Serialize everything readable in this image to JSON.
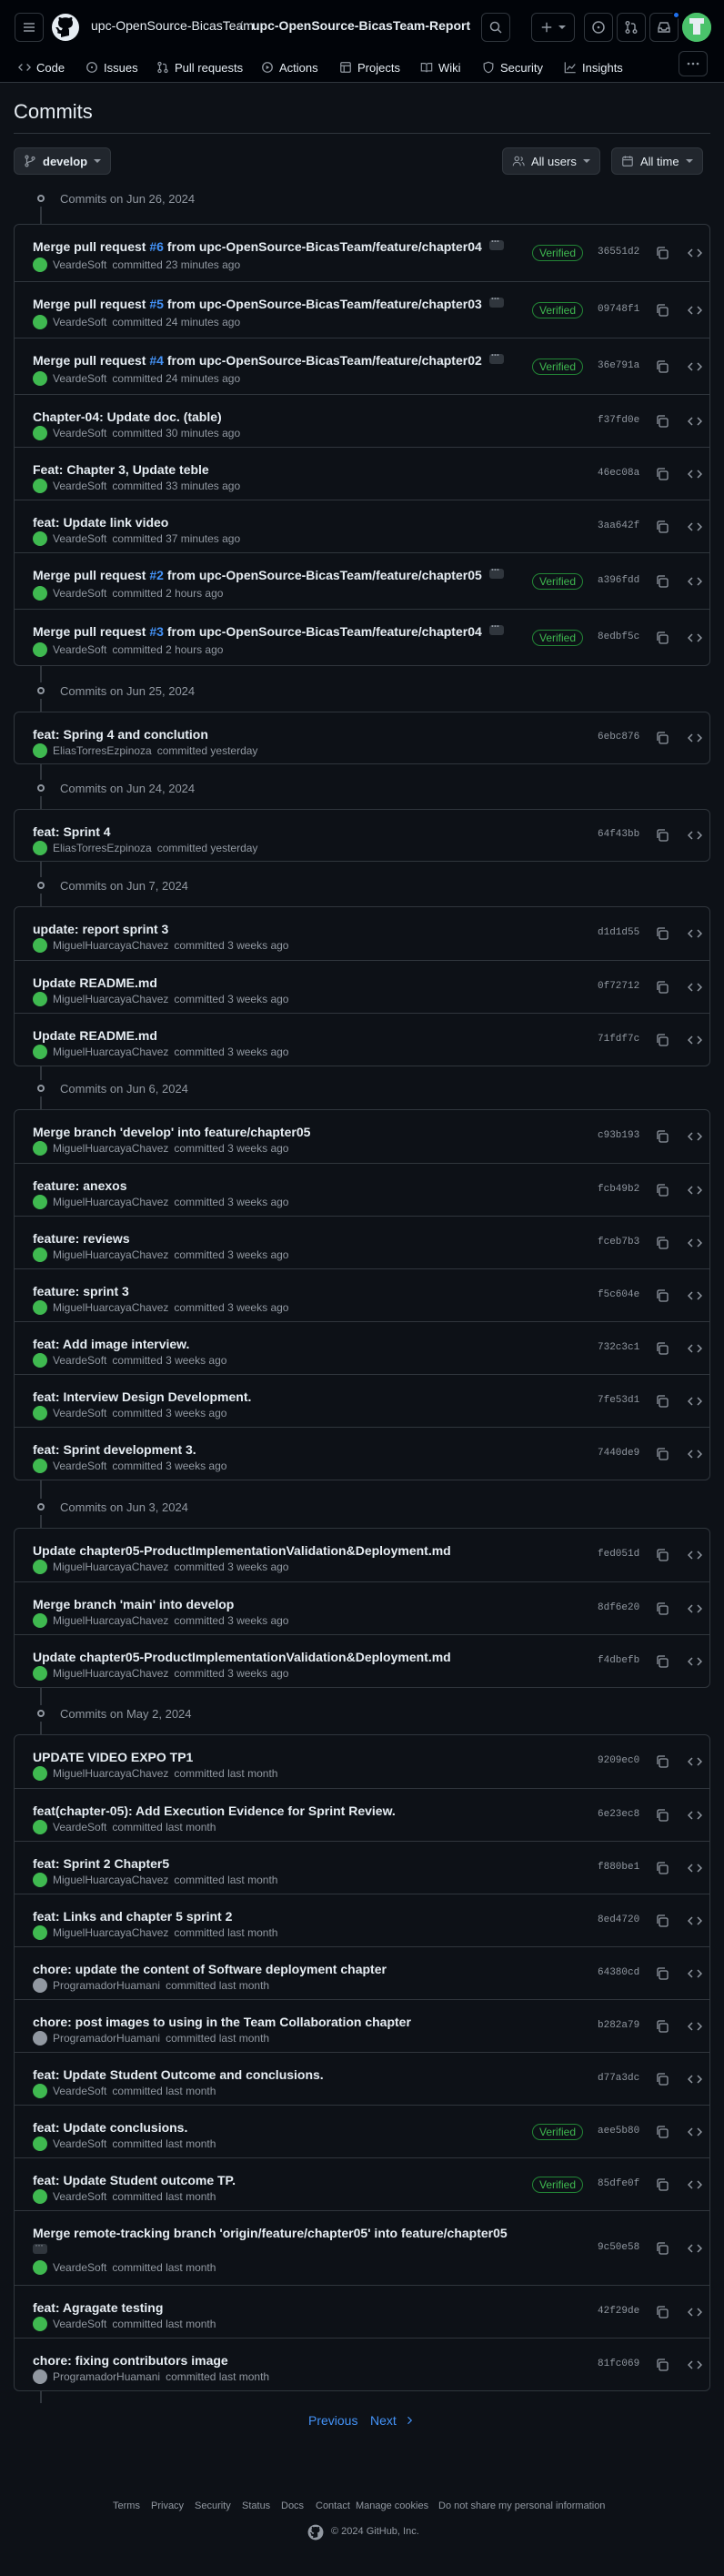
{
  "header": {
    "owner": "upc-OpenSource-BicasTeam",
    "separator": "/",
    "repo": "upc-OpenSource-BicasTeam-Report"
  },
  "tabs": [
    "Code",
    "Issues",
    "Pull requests",
    "Actions",
    "Projects",
    "Wiki",
    "Security",
    "Insights"
  ],
  "page_title": "Commits",
  "filters": {
    "branch": "develop",
    "users": "All users",
    "time": "All time"
  },
  "groups": [
    {
      "date": "Commits on Jun 26, 2024",
      "commits": [
        {
          "pre": "Merge pull request ",
          "pr": "#6",
          "post": " from upc-OpenSource-BicasTeam/feature/chapter04",
          "author": "VeardeSoft",
          "time": "committed 23 minutes ago",
          "sha": "36551d2",
          "verified": "Verified",
          "dots": true
        },
        {
          "pre": "Merge pull request ",
          "pr": "#5",
          "post": " from upc-OpenSource-BicasTeam/feature/chapter03",
          "author": "VeardeSoft",
          "time": "committed 24 minutes ago",
          "sha": "09748f1",
          "verified": "Verified",
          "dots": true
        },
        {
          "pre": "Merge pull request ",
          "pr": "#4",
          "post": " from upc-OpenSource-BicasTeam/feature/chapter02",
          "author": "VeardeSoft",
          "time": "committed 24 minutes ago",
          "sha": "36e791a",
          "verified": "Verified",
          "dots": true
        },
        {
          "pre": "Chapter-04: Update doc. (table)",
          "author": "VeardeSoft",
          "time": "committed 30 minutes ago",
          "sha": "f37fd0e"
        },
        {
          "pre": "Feat: Chapter 3, Update teble",
          "author": "VeardeSoft",
          "time": "committed 33 minutes ago",
          "sha": "46ec08a"
        },
        {
          "pre": "feat: Update link video",
          "author": "VeardeSoft",
          "time": "committed 37 minutes ago",
          "sha": "3aa642f"
        },
        {
          "pre": "Merge pull request ",
          "pr": "#2",
          "post": " from upc-OpenSource-BicasTeam/feature/chapter05",
          "author": "VeardeSoft",
          "time": "committed 2 hours ago",
          "sha": "a396fdd",
          "verified": "Verified",
          "dots": true
        },
        {
          "pre": "Merge pull request ",
          "pr": "#3",
          "post": " from upc-OpenSource-BicasTeam/feature/chapter04",
          "author": "VeardeSoft",
          "time": "committed 2 hours ago",
          "sha": "8edbf5c",
          "verified": "Verified",
          "dots": true
        }
      ]
    },
    {
      "date": "Commits on Jun 25, 2024",
      "commits": [
        {
          "pre": "feat: Spring 4 and conclution",
          "author": "EliasTorresEzpinoza",
          "time": "committed yesterday",
          "sha": "6ebc876"
        }
      ]
    },
    {
      "date": "Commits on Jun 24, 2024",
      "commits": [
        {
          "pre": "feat: Sprint 4",
          "author": "EliasTorresEzpinoza",
          "time": "committed yesterday",
          "sha": "64f43bb"
        }
      ]
    },
    {
      "date": "Commits on Jun 7, 2024",
      "commits": [
        {
          "pre": "update: report sprint 3",
          "author": "MiguelHuarcayaChavez",
          "time": "committed 3 weeks ago",
          "sha": "d1d1d55"
        },
        {
          "pre": "Update README.md",
          "author": "MiguelHuarcayaChavez",
          "time": "committed 3 weeks ago",
          "sha": "0f72712"
        },
        {
          "pre": "Update README.md",
          "author": "MiguelHuarcayaChavez",
          "time": "committed 3 weeks ago",
          "sha": "71fdf7c"
        }
      ]
    },
    {
      "date": "Commits on Jun 6, 2024",
      "commits": [
        {
          "pre": "Merge branch 'develop' into feature/chapter05",
          "author": "MiguelHuarcayaChavez",
          "time": "committed 3 weeks ago",
          "sha": "c93b193"
        },
        {
          "pre": "feature: anexos",
          "author": "MiguelHuarcayaChavez",
          "time": "committed 3 weeks ago",
          "sha": "fcb49b2"
        },
        {
          "pre": "feature: reviews",
          "author": "MiguelHuarcayaChavez",
          "time": "committed 3 weeks ago",
          "sha": "fceb7b3"
        },
        {
          "pre": "feature: sprint 3",
          "author": "MiguelHuarcayaChavez",
          "time": "committed 3 weeks ago",
          "sha": "f5c604e"
        },
        {
          "pre": "feat: Add image interview.",
          "author": "VeardeSoft",
          "time": "committed 3 weeks ago",
          "sha": "732c3c1"
        },
        {
          "pre": "feat: Interview Design Development.",
          "author": "VeardeSoft",
          "time": "committed 3 weeks ago",
          "sha": "7fe53d1"
        },
        {
          "pre": "feat: Sprint development 3.",
          "author": "VeardeSoft",
          "time": "committed 3 weeks ago",
          "sha": "7440de9"
        }
      ]
    },
    {
      "date": "Commits on Jun 3, 2024",
      "commits": [
        {
          "pre": "Update chapter05-ProductImplementationValidation&Deployment.md",
          "author": "MiguelHuarcayaChavez",
          "time": "committed 3 weeks ago",
          "sha": "fed051d"
        },
        {
          "pre": "Merge branch 'main' into develop",
          "author": "MiguelHuarcayaChavez",
          "time": "committed 3 weeks ago",
          "sha": "8df6e20"
        },
        {
          "pre": "Update chapter05-ProductImplementationValidation&Deployment.md",
          "author": "MiguelHuarcayaChavez",
          "time": "committed 3 weeks ago",
          "sha": "f4dbefb"
        }
      ]
    },
    {
      "date": "Commits on May 2, 2024",
      "commits": [
        {
          "pre": "UPDATE VIDEO EXPO TP1",
          "author": "MiguelHuarcayaChavez",
          "time": "committed last month",
          "sha": "9209ec0"
        },
        {
          "pre": "feat(chapter-05): Add Execution Evidence for Sprint Review.",
          "author": "VeardeSoft",
          "time": "committed last month",
          "sha": "6e23ec8"
        },
        {
          "pre": "feat: Sprint 2 Chapter5",
          "author": "MiguelHuarcayaChavez",
          "time": "committed last month",
          "sha": "f880be1"
        },
        {
          "pre": "feat: Links and chapter 5 sprint 2",
          "author": "MiguelHuarcayaChavez",
          "time": "committed last month",
          "sha": "8ed4720"
        },
        {
          "pre": "chore: update the content of Software deployment chapter",
          "author": "ProgramadorHuamani",
          "time": "committed last month",
          "sha": "64380cd",
          "grey": true
        },
        {
          "pre": "chore: post images to using in the Team Collaboration chapter",
          "author": "ProgramadorHuamani",
          "time": "committed last month",
          "sha": "b282a79",
          "grey": true
        },
        {
          "pre": "feat: Update Student Outcome and conclusions.",
          "author": "VeardeSoft",
          "time": "committed last month",
          "sha": "d77a3dc"
        },
        {
          "pre": "feat: Update conclusions.",
          "author": "VeardeSoft",
          "time": "committed last month",
          "sha": "aee5b80",
          "verified": "Verified"
        },
        {
          "pre": "feat: Update Student outcome TP.",
          "author": "VeardeSoft",
          "time": "committed last month",
          "sha": "85dfe0f",
          "verified": "Verified"
        },
        {
          "pre": "Merge remote-tracking branch 'origin/feature/chapter05' into feature/chapter05",
          "author": "VeardeSoft",
          "time": "committed last month",
          "sha": "9c50e58",
          "dots_line": true
        },
        {
          "pre": "feat: Agragate testing",
          "author": "VeardeSoft",
          "time": "committed last month",
          "sha": "42f29de"
        },
        {
          "pre": "chore: fixing contributors image",
          "author": "ProgramadorHuamani",
          "time": "committed last month",
          "sha": "81fc069",
          "grey": true
        }
      ]
    }
  ],
  "pagination": {
    "previous": "Previous",
    "next": "Next"
  },
  "footer": {
    "links": [
      "Terms",
      "Privacy",
      "Security",
      "Status",
      "Docs",
      "Contact",
      "Manage cookies",
      "Do not share my personal information"
    ],
    "copyright": "© 2024 GitHub, Inc."
  },
  "colors": {
    "bg": "#0d1117",
    "border": "#30363d",
    "link": "#4493f8",
    "verified": "#3fb950",
    "muted": "#9198a1"
  }
}
